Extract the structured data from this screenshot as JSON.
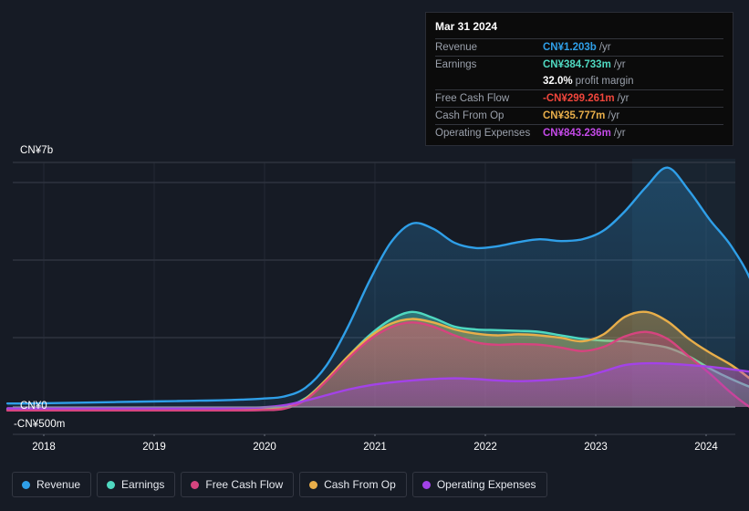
{
  "chart_data": {
    "type": "area",
    "title": "",
    "xlabel": "",
    "ylabel": "",
    "currency": "CN¥",
    "grid": true,
    "legend_position": "bottom",
    "ylim": [
      -500000000,
      7000000000
    ],
    "y_ticks": [
      {
        "label": "CN¥7b",
        "value": 7000000000
      },
      {
        "label": "CN¥0",
        "value": 0
      },
      {
        "label": "-CN¥500m",
        "value": -500000000
      }
    ],
    "x_ticks": [
      "2018",
      "2019",
      "2020",
      "2021",
      "2022",
      "2023",
      "2024"
    ],
    "x_range": [
      "2017-09",
      "2024-09"
    ],
    "forecast_start": "2023-04",
    "series": [
      {
        "name": "Revenue",
        "color": "#2f9fe8",
        "values": [
          0.1,
          0.1,
          0.11,
          0.12,
          0.13,
          0.14,
          0.15,
          0.16,
          0.17,
          0.18,
          0.19,
          0.21,
          0.24,
          0.3,
          0.55,
          1.2,
          2.3,
          3.6,
          4.7,
          5.25,
          5.1,
          4.7,
          4.55,
          4.6,
          4.72,
          4.8,
          4.75,
          4.8,
          5.05,
          5.6,
          6.3,
          6.85,
          6.2,
          5.35,
          4.6,
          3.5,
          1.6,
          1.2,
          1.203
        ]
      },
      {
        "name": "Earnings",
        "color": "#4fd8c0",
        "values": [
          -0.06,
          -0.06,
          -0.06,
          -0.06,
          -0.06,
          -0.06,
          -0.06,
          -0.06,
          -0.06,
          -0.06,
          -0.06,
          -0.05,
          -0.04,
          0.0,
          0.25,
          0.8,
          1.45,
          2.05,
          2.5,
          2.72,
          2.55,
          2.3,
          2.22,
          2.2,
          2.18,
          2.15,
          2.05,
          1.95,
          1.9,
          1.88,
          1.8,
          1.7,
          1.45,
          1.1,
          0.8,
          0.55,
          0.4,
          0.385,
          0.384733
        ]
      },
      {
        "name": "Free Cash Flow",
        "color": "#d6447f",
        "values": [
          -0.1,
          -0.1,
          -0.1,
          -0.1,
          -0.1,
          -0.1,
          -0.1,
          -0.1,
          -0.1,
          -0.1,
          -0.1,
          -0.1,
          -0.09,
          -0.05,
          0.2,
          0.75,
          1.38,
          1.92,
          2.28,
          2.42,
          2.3,
          2.05,
          1.85,
          1.78,
          1.8,
          1.78,
          1.7,
          1.6,
          1.72,
          2.02,
          2.15,
          1.95,
          1.45,
          0.95,
          0.4,
          -0.05,
          -0.28,
          -0.3,
          -0.299261
        ]
      },
      {
        "name": "Cash From Op",
        "color": "#e8ae4a",
        "values": [
          -0.09,
          -0.09,
          -0.09,
          -0.09,
          -0.09,
          -0.09,
          -0.09,
          -0.09,
          -0.09,
          -0.09,
          -0.09,
          -0.09,
          -0.08,
          -0.03,
          0.23,
          0.8,
          1.45,
          2.0,
          2.38,
          2.52,
          2.42,
          2.22,
          2.1,
          2.05,
          2.08,
          2.05,
          1.98,
          1.88,
          2.08,
          2.58,
          2.72,
          2.45,
          1.95,
          1.55,
          1.2,
          0.75,
          0.2,
          0.05,
          0.035777
        ]
      },
      {
        "name": "Operating Expenses",
        "color": "#a342e8",
        "values": [
          -0.04,
          -0.04,
          -0.04,
          -0.04,
          -0.04,
          -0.04,
          -0.04,
          -0.04,
          -0.04,
          -0.04,
          -0.04,
          -0.03,
          -0.01,
          0.05,
          0.18,
          0.34,
          0.5,
          0.62,
          0.7,
          0.76,
          0.8,
          0.82,
          0.8,
          0.76,
          0.74,
          0.76,
          0.8,
          0.86,
          1.02,
          1.2,
          1.25,
          1.24,
          1.2,
          1.15,
          1.08,
          1.0,
          0.92,
          0.86,
          0.843236
        ]
      }
    ]
  },
  "tooltip": {
    "date": "Mar 31 2024",
    "rows": [
      {
        "key": "Revenue",
        "value": "CN¥1.203b",
        "unit": "/yr",
        "color": "#2f9fe8",
        "rule": true
      },
      {
        "key": "Earnings",
        "value": "CN¥384.733m",
        "unit": "/yr",
        "color": "#4fd8c0",
        "rule": true
      },
      {
        "key": "",
        "value": "32.0%",
        "unit": "profit margin",
        "color": "#ffffff",
        "rule": false
      },
      {
        "key": "Free Cash Flow",
        "value": "-CN¥299.261m",
        "unit": "/yr",
        "color": "#f0463c",
        "rule": true
      },
      {
        "key": "Cash From Op",
        "value": "CN¥35.777m",
        "unit": "/yr",
        "color": "#e8ae4a",
        "rule": true
      },
      {
        "key": "Operating Expenses",
        "value": "CN¥843.236m",
        "unit": "/yr",
        "color": "#c44ae8",
        "rule": true
      }
    ]
  },
  "legend": {
    "items": [
      {
        "label": "Revenue",
        "color": "#2f9fe8"
      },
      {
        "label": "Earnings",
        "color": "#4fd8c0"
      },
      {
        "label": "Free Cash Flow",
        "color": "#d6447f"
      },
      {
        "label": "Cash From Op",
        "color": "#e8ae4a"
      },
      {
        "label": "Operating Expenses",
        "color": "#a342e8"
      }
    ]
  }
}
